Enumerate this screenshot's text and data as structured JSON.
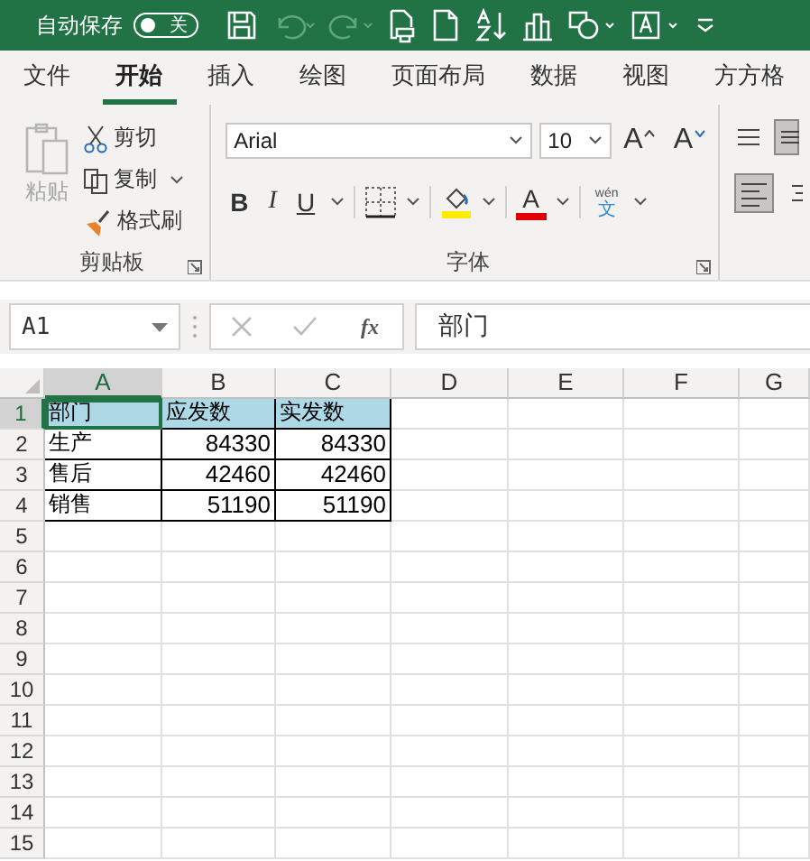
{
  "title_bar": {
    "autosave_label": "自动保存",
    "autosave_toggle": {
      "label": "关",
      "on": false
    }
  },
  "tabs": [
    {
      "label": "文件",
      "selected": false
    },
    {
      "label": "开始",
      "selected": true
    },
    {
      "label": "插入",
      "selected": false
    },
    {
      "label": "绘图",
      "selected": false
    },
    {
      "label": "页面布局",
      "selected": false
    },
    {
      "label": "数据",
      "selected": false
    },
    {
      "label": "视图",
      "selected": false
    },
    {
      "label": "方方格",
      "selected": false
    }
  ],
  "clipboard_group": {
    "paste": {
      "label": "粘贴",
      "disabled": true
    },
    "cut": "剪切",
    "copy": "复制",
    "format_painter": "格式刷",
    "label": "剪贴板"
  },
  "font_group": {
    "font_name": "Arial",
    "font_size": "10",
    "grow": "A",
    "shrink": "A",
    "bold": "B",
    "italic": "I",
    "underline": "U",
    "font_color": "A",
    "phonetic_top": "wén",
    "phonetic_bottom": "文",
    "label": "字体"
  },
  "formula_bar": {
    "name_box": "A1",
    "fx": "fx",
    "value": "部门"
  },
  "sheet": {
    "columns": [
      {
        "label": "A",
        "selected": true
      },
      {
        "label": "B",
        "selected": false
      },
      {
        "label": "C",
        "selected": false
      },
      {
        "label": "D",
        "selected": false
      },
      {
        "label": "E",
        "selected": false
      },
      {
        "label": "F",
        "selected": false
      },
      {
        "label": "G",
        "selected": false
      }
    ],
    "rows": [
      {
        "number": "1",
        "selected": true,
        "cells": [
          {
            "text": "部门",
            "kind": "text",
            "highlighted": true,
            "selected": true
          },
          {
            "text": "应发数",
            "kind": "text",
            "highlighted": true,
            "selected": false
          },
          {
            "text": "实发数",
            "kind": "text",
            "highlighted": true,
            "selected": false
          }
        ]
      },
      {
        "number": "2",
        "selected": false,
        "cells": [
          {
            "text": "生产",
            "kind": "text",
            "highlighted": false,
            "selected": false
          },
          {
            "text": "84330",
            "kind": "number",
            "highlighted": false,
            "selected": false
          },
          {
            "text": "84330",
            "kind": "number",
            "highlighted": false,
            "selected": false
          }
        ]
      },
      {
        "number": "3",
        "selected": false,
        "cells": [
          {
            "text": "售后",
            "kind": "text",
            "highlighted": false,
            "selected": false
          },
          {
            "text": "42460",
            "kind": "number",
            "highlighted": false,
            "selected": false
          },
          {
            "text": "42460",
            "kind": "number",
            "highlighted": false,
            "selected": false
          }
        ]
      },
      {
        "number": "4",
        "selected": false,
        "cells": [
          {
            "text": "销售",
            "kind": "text",
            "highlighted": false,
            "selected": false
          },
          {
            "text": "51190",
            "kind": "number",
            "highlighted": false,
            "selected": false
          },
          {
            "text": "51190",
            "kind": "number",
            "highlighted": false,
            "selected": false
          }
        ]
      },
      {
        "number": "5",
        "selected": false,
        "cells": []
      },
      {
        "number": "6",
        "selected": false,
        "cells": []
      },
      {
        "number": "7",
        "selected": false,
        "cells": []
      },
      {
        "number": "8",
        "selected": false,
        "cells": []
      },
      {
        "number": "9",
        "selected": false,
        "cells": []
      },
      {
        "number": "10",
        "selected": false,
        "cells": []
      },
      {
        "number": "11",
        "selected": false,
        "cells": []
      },
      {
        "number": "12",
        "selected": false,
        "cells": []
      },
      {
        "number": "13",
        "selected": false,
        "cells": []
      },
      {
        "number": "14",
        "selected": false,
        "cells": []
      },
      {
        "number": "15",
        "selected": false,
        "cells": []
      }
    ]
  }
}
